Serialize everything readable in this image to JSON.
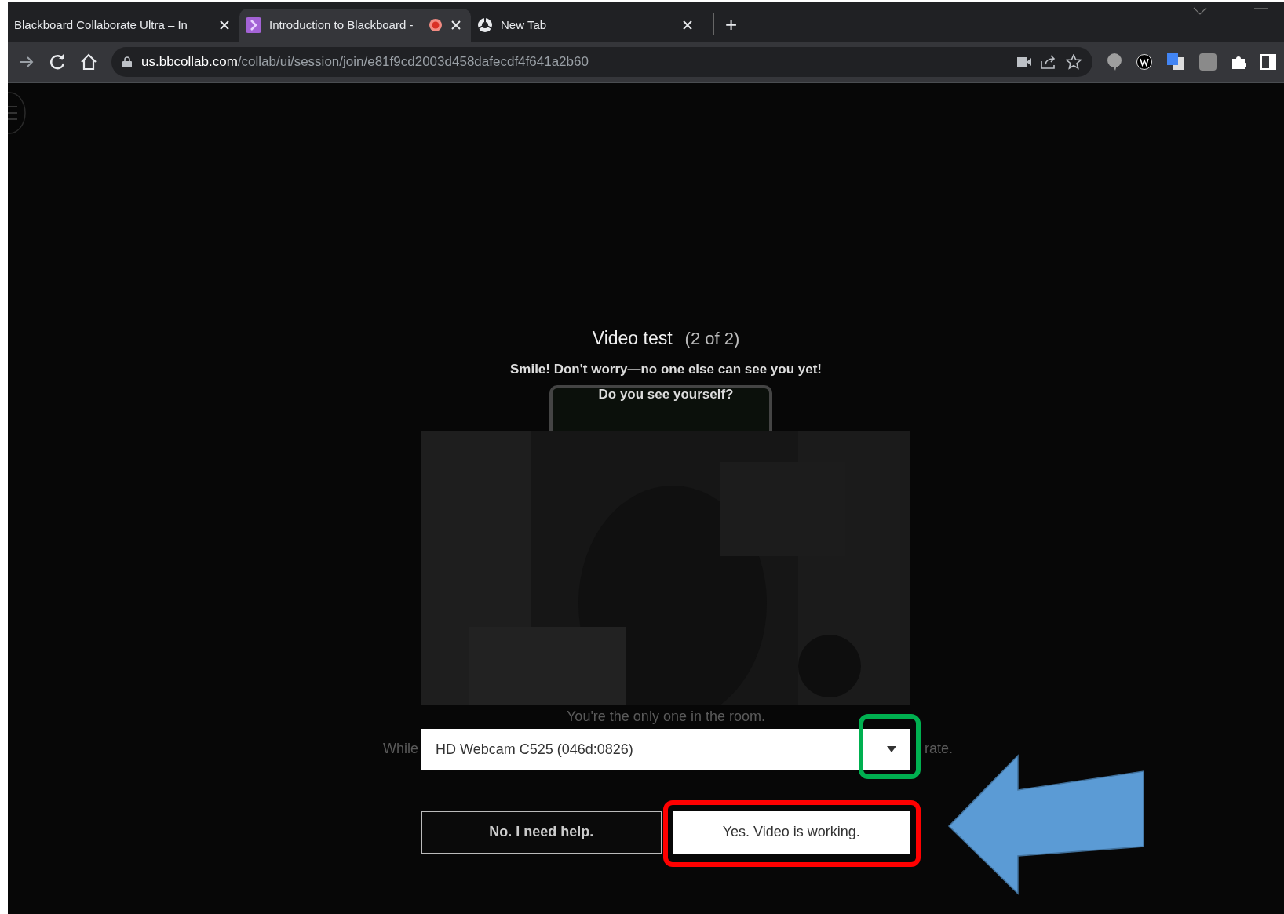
{
  "browser": {
    "tabs": [
      {
        "title": "Blackboard Collaborate Ultra – In",
        "recording": false,
        "selected": false
      },
      {
        "title": "Introduction to Blackboard -",
        "recording": true,
        "selected": true
      },
      {
        "title": "New Tab",
        "recording": false,
        "selected": false
      }
    ],
    "new_tab": "+",
    "url_host": "us.bbcollab.com",
    "url_path": "/collab/ui/session/join/e81f9cd2003d458dafecdf4f641a2b60"
  },
  "dialog": {
    "title": "Video test",
    "step": "(2 of 2)",
    "lines": [
      "Smile! Don't worry—no one else can see you yet!",
      "Do you see yourself?"
    ],
    "behind_text": "You're the only one in the room.",
    "behind_left": "While",
    "behind_right": "rate.",
    "camera_select": {
      "value": "HD Webcam C525 (046d:0826)"
    },
    "buttons": [
      {
        "label": "No. I need help.",
        "kind": "outline"
      },
      {
        "label": "Yes. Video is working.",
        "kind": "solid"
      }
    ]
  },
  "annotations": [
    {
      "kind": "box",
      "color": "#00b050"
    },
    {
      "kind": "box",
      "color": "#ff0000"
    },
    {
      "kind": "arrow",
      "color": "#5b9bd5"
    }
  ]
}
